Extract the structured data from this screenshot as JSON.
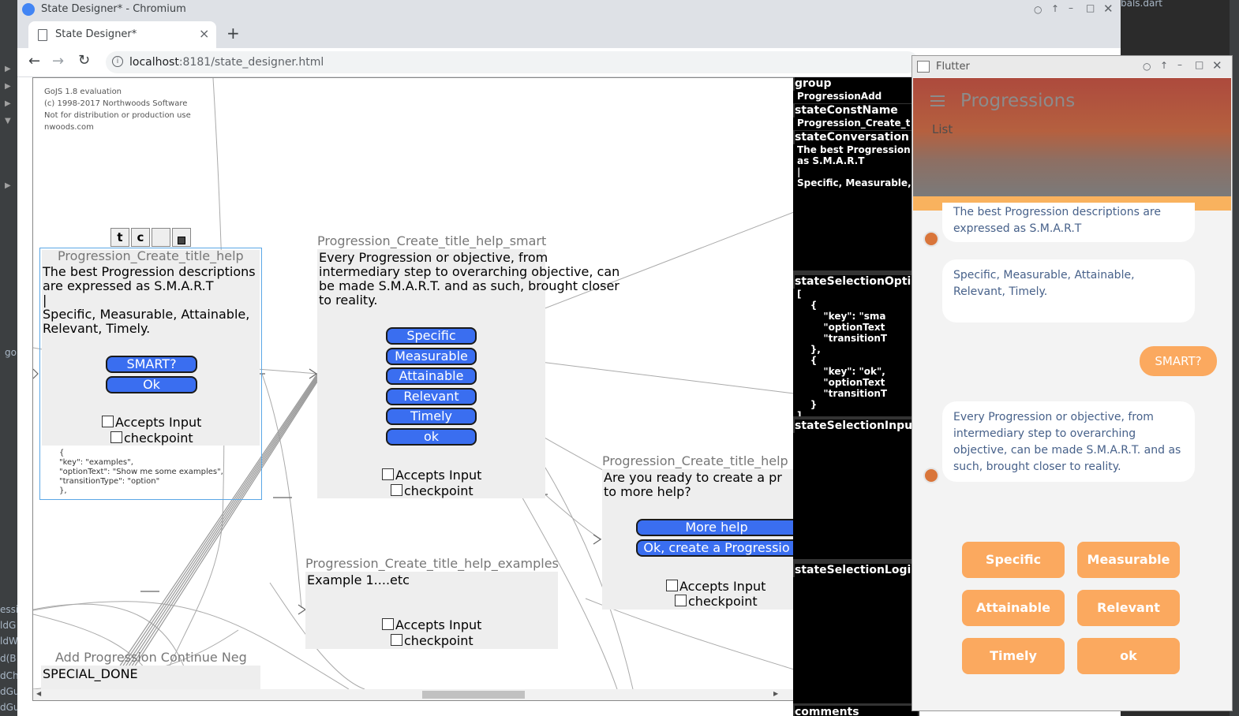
{
  "ide": {
    "right_tab": "bals.dart",
    "left_fragments": [
      "go",
      "essi",
      "ldG",
      "ldW",
      "d(B",
      "dCh",
      "dGu",
      "dGu"
    ],
    "right_fragments": [
      "M",
      "a",
      "p",
      "s",
      "p",
      "d",
      "l",
      "i"
    ]
  },
  "browser": {
    "window_title": "State Designer* - Chromium",
    "tab_title": "State Designer*",
    "url_host": "localhost",
    "url_path": ":8181/state_designer.html",
    "new_tab": "+",
    "close_tab": "×"
  },
  "diagram": {
    "watermark": [
      "GoJS 1.8 evaluation",
      "(c) 1998-2017 Northwoods Software",
      "Not for distribution or production use",
      "nwoods.com"
    ],
    "toolbar_buttons": [
      "t",
      "c",
      ""
    ],
    "nodes": {
      "help": {
        "title": "Progression_Create_title_help",
        "text": "The best Progression descriptions are expressed as S.M.A.R.T\n|\nSpecific, Measurable, Attainable, Relevant, Timely.",
        "buttons": [
          "SMART?",
          "Ok"
        ],
        "accepts_input": "Accepts Input",
        "checkpoint": "checkpoint",
        "json": "{\n\"key\": \"examples\",\n\"optionText\": \"Show me some examples\",\n\"transitionType\": \"option\"\n},"
      },
      "smart": {
        "title": "Progression_Create_title_help_smart",
        "text": "Every Progression or objective, from intermediary step to overarching objective, can be made S.M.A.R.T. and as such, brought closer to reality.",
        "buttons": [
          "Specific",
          "Measurable",
          "Attainable",
          "Relevant",
          "Timely",
          "ok"
        ],
        "accepts_input": "Accepts Input",
        "checkpoint": "checkpoint"
      },
      "ready": {
        "title": "Progression_Create_title_help",
        "text": "Are you ready to create a pr to more help?",
        "buttons": [
          "More help",
          "Ok, create a Progressio"
        ],
        "accepts_input": "Accepts Input",
        "checkpoint": "checkpoint"
      },
      "examples": {
        "title": "Progression_Create_title_help_examples",
        "text": "Example 1....etc",
        "accepts_input": "Accepts Input",
        "checkpoint": "checkpoint"
      },
      "neg": {
        "title": "Add Progression Continue Neg",
        "text": "SPECIAL_DONE"
      }
    }
  },
  "inspector": {
    "group_label": "group",
    "group_value": "ProgressionAdd",
    "state_const_name_label": "stateConstName",
    "state_const_name_value": "Progression_Create_t",
    "state_conversation_label": "stateConversation",
    "state_conversation_value": "The best Progression\nas S.M.A.R.T\n|\nSpecific, Measurable,",
    "state_selection_options_label": "stateSelectionOpti",
    "state_selection_options_value": "[\n    {\n        \"key\": \"sma\n        \"optionText\n        \"transitionT\n    },\n    {\n        \"key\": \"ok\",\n        \"optionText\n        \"transitionT\n    }\n]",
    "state_selection_input_label": "stateSelectionInpu",
    "state_selection_logic_label": "stateSelectionLogi",
    "comments_label": "comments"
  },
  "flutter": {
    "window_title": "Flutter",
    "app_title": "Progressions",
    "subtitle": "List",
    "messages": [
      {
        "from": "bot",
        "text": "The best Progression descriptions are expressed as S.M.A.R.T"
      },
      {
        "from": "bot",
        "text": "Specific, Measurable, Attainable, Relevant, Timely."
      },
      {
        "from": "user",
        "text": "SMART?"
      },
      {
        "from": "bot",
        "text": "Every Progression or objective, from intermediary step to overarching objective, can be made S.M.A.R.T. and as such, brought closer to reality."
      }
    ],
    "options": [
      "Specific",
      "Measurable",
      "Attainable",
      "Relevant",
      "Timely",
      "ok"
    ],
    "accent": "#fba95f"
  }
}
